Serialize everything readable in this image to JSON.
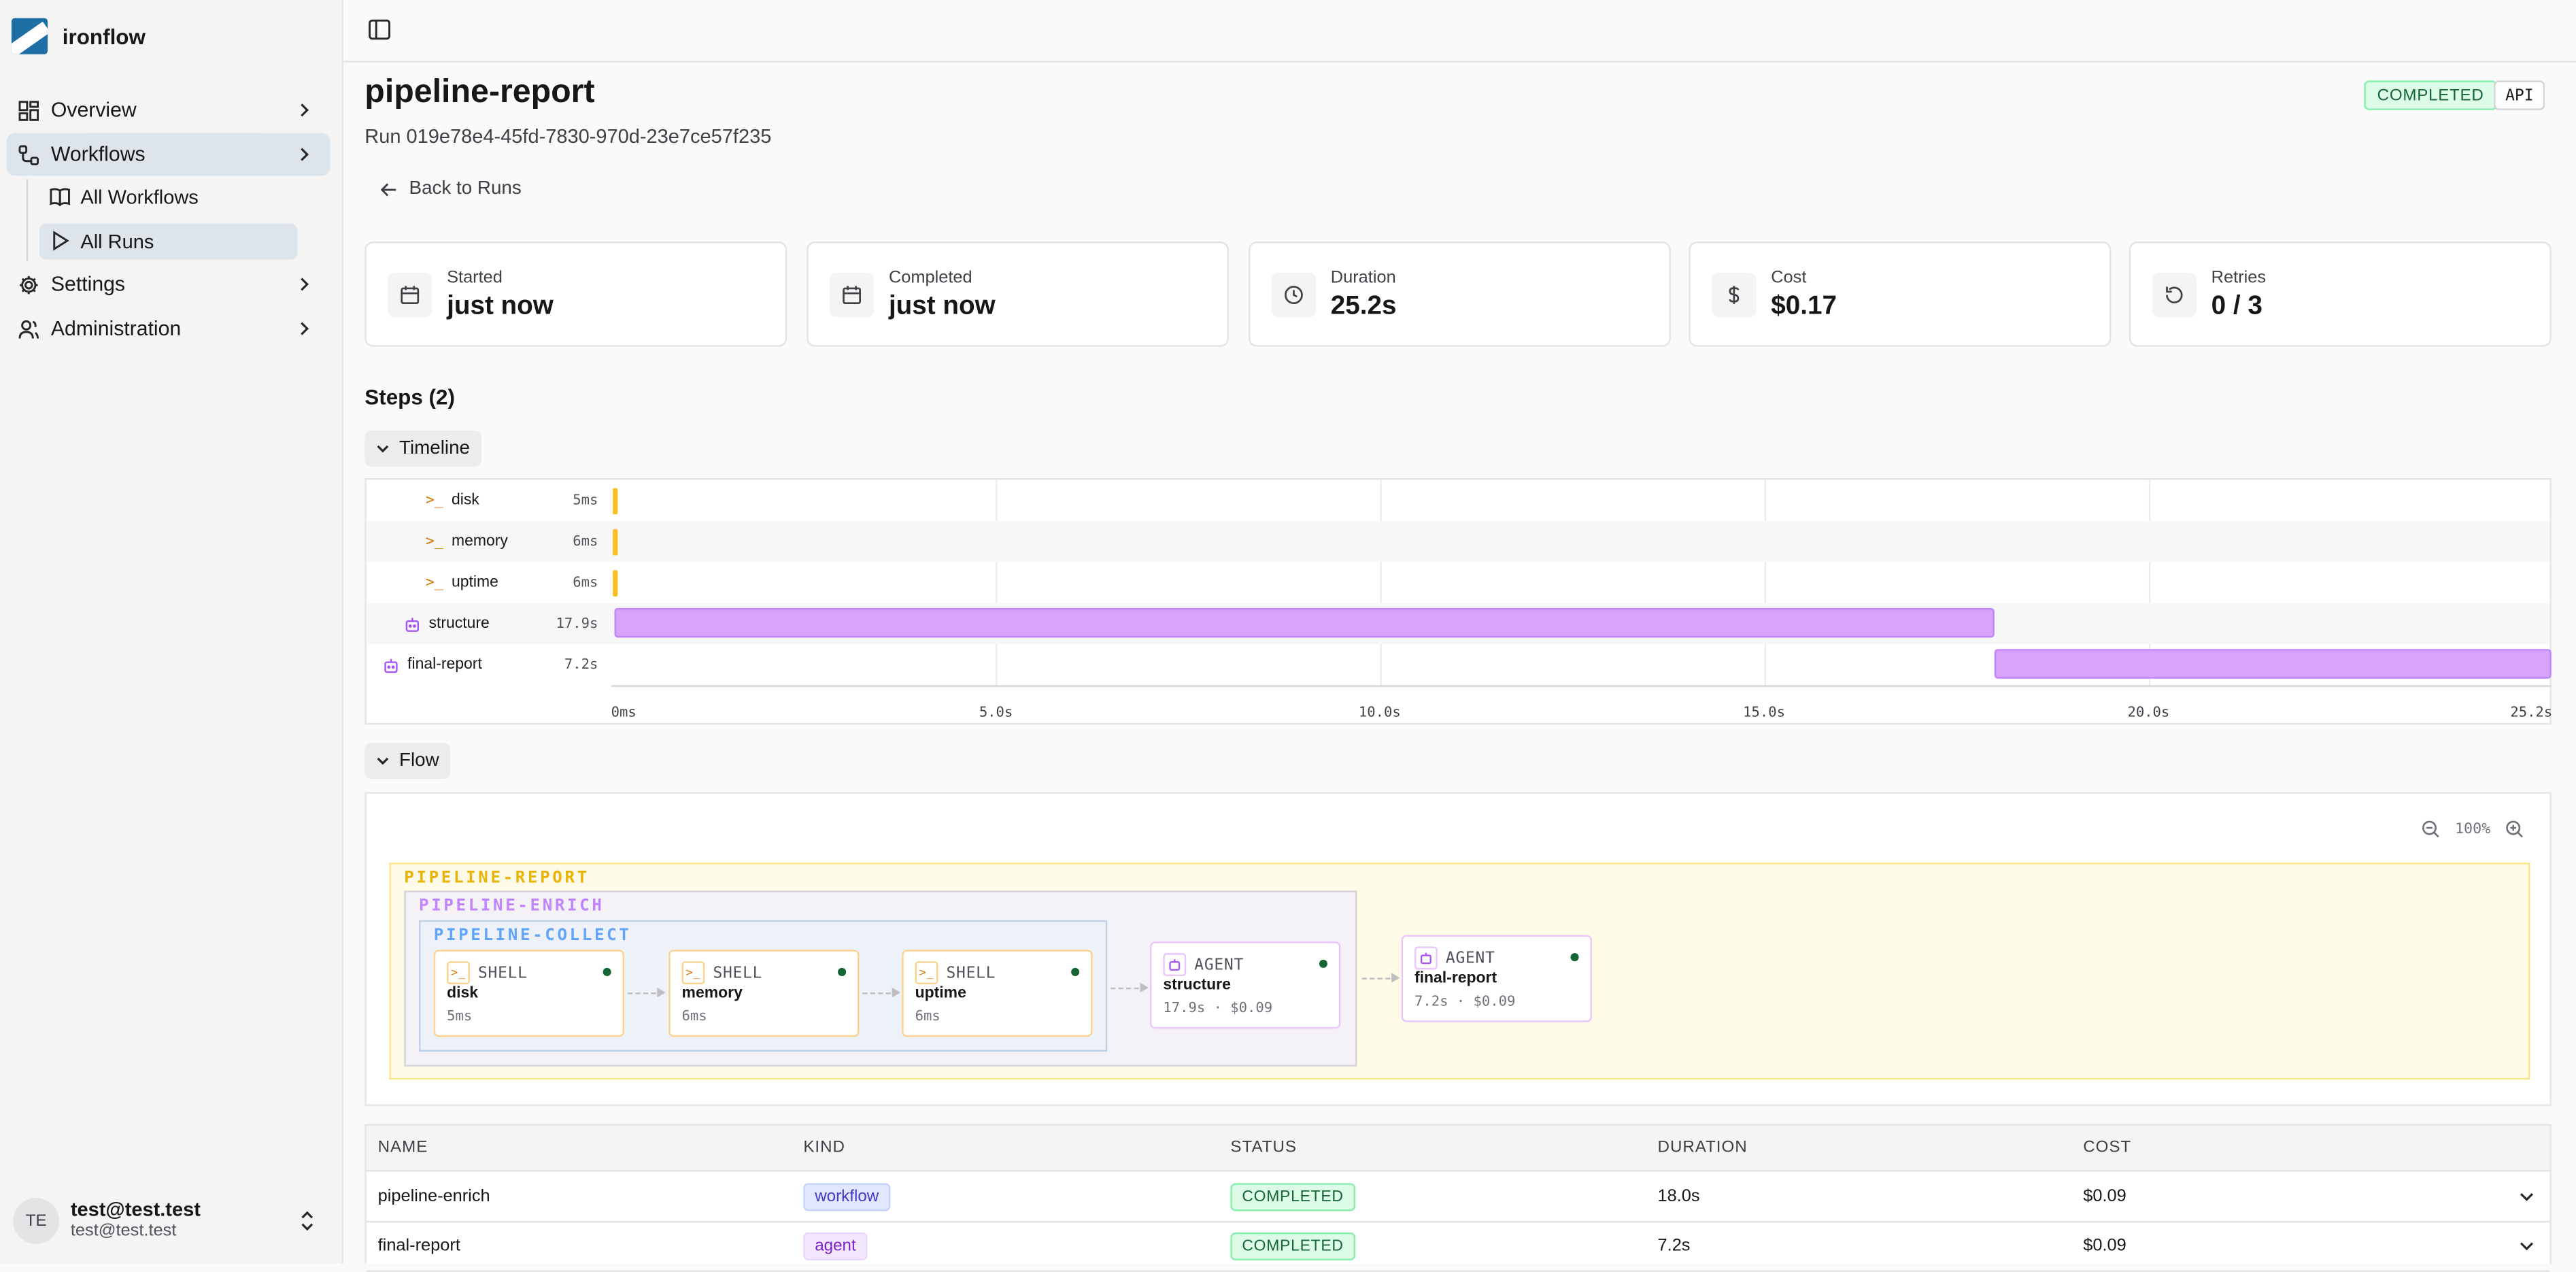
{
  "app": {
    "name": "ironflow"
  },
  "sidebar": {
    "items": [
      {
        "label": "Overview"
      },
      {
        "label": "Workflows"
      },
      {
        "label": "Settings"
      },
      {
        "label": "Administration"
      }
    ],
    "subitems": [
      {
        "label": "All Workflows"
      },
      {
        "label": "All Runs"
      }
    ],
    "user": {
      "initials": "TE",
      "name": "test@test.test",
      "email": "test@test.test"
    }
  },
  "header": {
    "title": "pipeline-report",
    "run_id": "Run 019e78e4-45fd-7830-970d-23e7ce57f235",
    "status_badge": "COMPLETED",
    "trigger_badge": "API",
    "back_label": "Back to Runs"
  },
  "stats": [
    {
      "label": "Started",
      "value": "just now",
      "icon": "calendar-icon"
    },
    {
      "label": "Completed",
      "value": "just now",
      "icon": "calendar-icon"
    },
    {
      "label": "Duration",
      "value": "25.2s",
      "icon": "clock-icon"
    },
    {
      "label": "Cost",
      "value": "$0.17",
      "icon": "dollar-icon"
    },
    {
      "label": "Retries",
      "value": "0 / 3",
      "icon": "retry-icon"
    }
  ],
  "steps_title": "Steps (2)",
  "timeline": {
    "toggle_label": "Timeline",
    "total_seconds": 25.2,
    "rows": [
      {
        "name": "disk",
        "duration": "5ms",
        "kind": "shell",
        "start_s": 0,
        "end_s": 0.005
      },
      {
        "name": "memory",
        "duration": "6ms",
        "kind": "shell",
        "start_s": 0,
        "end_s": 0.006
      },
      {
        "name": "uptime",
        "duration": "6ms",
        "kind": "shell",
        "start_s": 0,
        "end_s": 0.006
      },
      {
        "name": "structure",
        "duration": "17.9s",
        "kind": "agent",
        "start_s": 0.02,
        "end_s": 17.95
      },
      {
        "name": "final-report",
        "duration": "7.2s",
        "kind": "agent",
        "start_s": 17.97,
        "end_s": 25.2
      }
    ],
    "ticks": [
      "0ms",
      "5.0s",
      "10.0s",
      "15.0s",
      "20.0s",
      "25.2s"
    ],
    "colors": {
      "shell": "#fbbf24",
      "agent": "#d8a4fb"
    }
  },
  "flow": {
    "toggle_label": "Flow",
    "zoom": "100%",
    "groups": [
      {
        "label": "PIPELINE-REPORT",
        "color": "#eab308"
      },
      {
        "label": "PIPELINE-ENRICH",
        "color": "#c084fc"
      },
      {
        "label": "PIPELINE-COLLECT",
        "color": "#60a5fa"
      }
    ],
    "nodes": [
      {
        "kind": "SHELL",
        "name": "disk",
        "meta": "5ms"
      },
      {
        "kind": "SHELL",
        "name": "memory",
        "meta": "6ms"
      },
      {
        "kind": "SHELL",
        "name": "uptime",
        "meta": "6ms"
      },
      {
        "kind": "AGENT",
        "name": "structure",
        "meta": "17.9s · $0.09"
      },
      {
        "kind": "AGENT",
        "name": "final-report",
        "meta": "7.2s · $0.09"
      }
    ]
  },
  "table": {
    "headers": [
      "NAME",
      "KIND",
      "STATUS",
      "DURATION",
      "COST"
    ],
    "rows": [
      {
        "name": "pipeline-enrich",
        "kind": "workflow",
        "status": "COMPLETED",
        "duration": "18.0s",
        "cost": "$0.09"
      },
      {
        "name": "final-report",
        "kind": "agent",
        "status": "COMPLETED",
        "duration": "7.2s",
        "cost": "$0.09"
      }
    ]
  }
}
